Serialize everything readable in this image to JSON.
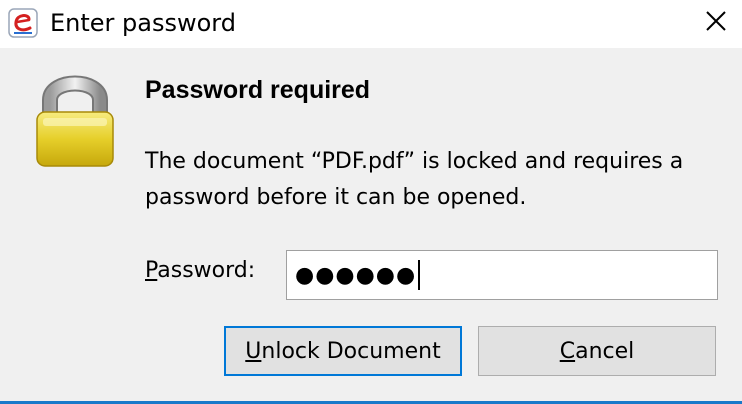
{
  "window": {
    "title": "Enter password",
    "app_icon": "pdf-reader-app-icon",
    "close_icon": "close-icon"
  },
  "dialog": {
    "lock_icon": "padlock-icon",
    "heading": "Password required",
    "message": "The document “PDF.pdf” is locked and requires a password before it can be opened.",
    "password_label_mnemonic": "P",
    "password_label_rest": "assword:",
    "password_value": "●●●●●●"
  },
  "buttons": {
    "unlock_mnemonic": "U",
    "unlock_rest": "nlock Document",
    "cancel_mnemonic": "C",
    "cancel_rest": "ancel"
  },
  "colors": {
    "accent": "#0078d7",
    "window_bg": "#f0f0f0",
    "titlebar_bg": "#ffffff"
  }
}
